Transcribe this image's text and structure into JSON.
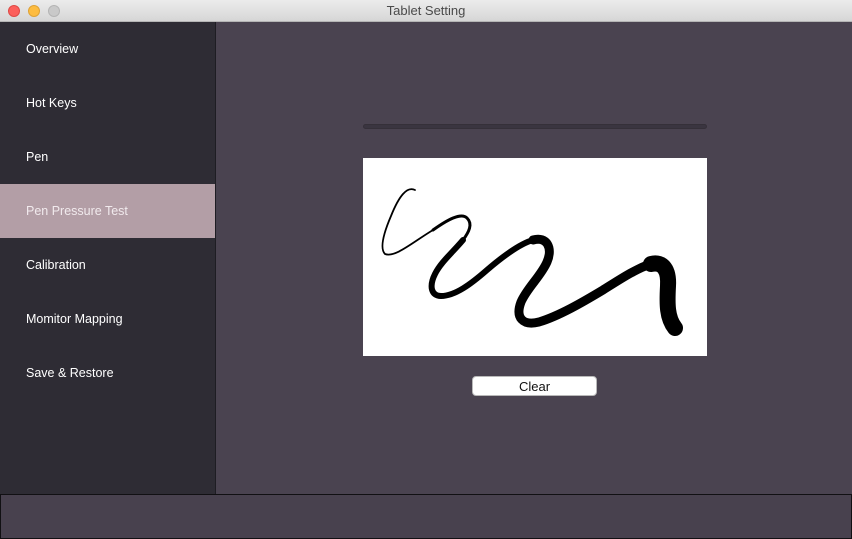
{
  "window": {
    "title": "Tablet Setting"
  },
  "sidebar": {
    "items": [
      {
        "label": "Overview",
        "active": false
      },
      {
        "label": "Hot Keys",
        "active": false
      },
      {
        "label": "Pen",
        "active": false
      },
      {
        "label": "Pen Pressure Test",
        "active": true
      },
      {
        "label": "Calibration",
        "active": false
      },
      {
        "label": "Momitor Mapping",
        "active": false
      },
      {
        "label": "Save & Restore",
        "active": false
      }
    ]
  },
  "main": {
    "pressure_level": 0,
    "clear_label": "Clear"
  },
  "colors": {
    "sidebar_bg": "#2e2c34",
    "active_item_bg": "#b39ea6",
    "main_bg": "#4a4350"
  }
}
